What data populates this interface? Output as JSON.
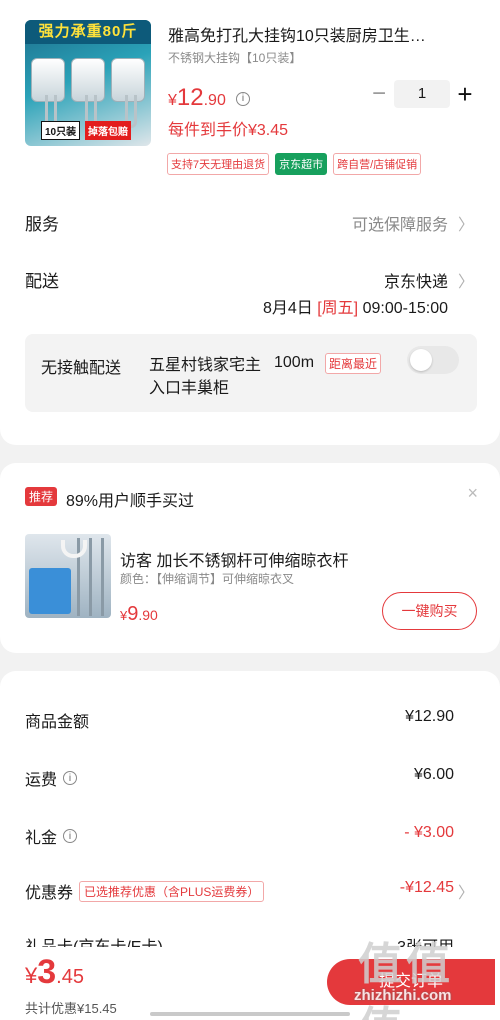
{
  "product": {
    "image": {
      "banner": "强力承重80斤",
      "tag_count": "10只装",
      "tag_guarantee": "掉落包赔"
    },
    "title": "雅高免打孔大挂钩10只装厨房卫生…",
    "sku": "不锈钢大挂钩【10只装】",
    "price_currency": "¥",
    "price_int": "12",
    "price_dec": ".90",
    "price_each": "每件到手价¥3.45",
    "quantity": "1",
    "minus_symbol": "−",
    "plus_symbol": "+",
    "tags": [
      "支持7天无理由退货",
      "京东超市",
      "跨自营/店铺促销"
    ]
  },
  "service": {
    "label": "服务",
    "value": "可选保障服务"
  },
  "delivery": {
    "label": "配送",
    "carrier": "京东快递",
    "date": "8月4日",
    "weekday": "[周五]",
    "time": "09:00-15:00",
    "contactless": {
      "label": "无接触配送",
      "address": "五星村钱家宅主入口丰巢柜",
      "distance": "100m",
      "nearest": "距离最近"
    }
  },
  "recommendation": {
    "badge": "推荐",
    "headline": "89%用户顺手买过",
    "close": "×",
    "title": "访客 加长不锈钢杆可伸缩晾衣杆",
    "sku": "颜色：【伸缩调节】可伸缩晾衣叉",
    "price_currency": "¥",
    "price_int": "9",
    "price_dec": ".90",
    "buy_label": "一键购买"
  },
  "summary": {
    "goods_amount_label": "商品金额",
    "goods_amount": "¥12.90",
    "shipping_label": "运费",
    "shipping": "¥6.00",
    "gift_label": "礼金",
    "gift": "- ¥3.00",
    "coupon_label": "优惠券",
    "coupon_tag": "已选推荐优惠（含PLUS运费券）",
    "coupon": "-¥12.45",
    "giftcard_label": "礼品卡(京东卡/E卡)",
    "giftcard": "3张可用"
  },
  "bottom": {
    "total_currency": "¥",
    "total_int": "3",
    "total_dec": ".45",
    "total_saving": "共计优惠¥15.45",
    "submit_label": "提交订单"
  },
  "watermark": {
    "glyphs": "值值值",
    "url": "zhizhizhi.com"
  },
  "icons": {
    "info": "i",
    "chevron": "〉"
  },
  "colors": {
    "accent": "#e4393c",
    "supermarket_green": "#17a05d"
  }
}
